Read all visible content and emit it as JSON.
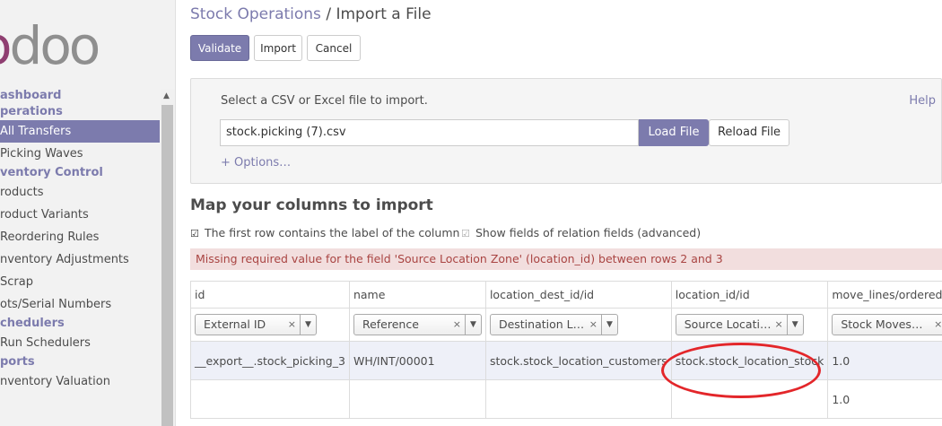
{
  "app": {
    "logo_first": "o",
    "logo_rest": "doo"
  },
  "sidebar": {
    "items": [
      {
        "label": "ashboard",
        "kind": "cat"
      },
      {
        "label": "perations",
        "kind": "cat"
      },
      {
        "label": "All Transfers",
        "kind": "active"
      },
      {
        "label": "Picking Waves",
        "kind": "sub"
      },
      {
        "label": "ventory Control",
        "kind": "cat"
      },
      {
        "label": "roducts",
        "kind": "sub"
      },
      {
        "label": "roduct Variants",
        "kind": "sub"
      },
      {
        "label": "Reordering Rules",
        "kind": "sub"
      },
      {
        "label": "nventory Adjustments",
        "kind": "sub"
      },
      {
        "label": "Scrap",
        "kind": "sub"
      },
      {
        "label": "ots/Serial Numbers",
        "kind": "sub"
      },
      {
        "label": "chedulers",
        "kind": "cat"
      },
      {
        "label": "Run Schedulers",
        "kind": "sub"
      },
      {
        "label": "ports",
        "kind": "cat"
      },
      {
        "label": "nventory Valuation",
        "kind": "sub"
      }
    ]
  },
  "header": {
    "crumb_link": "Stock Operations",
    "separator": "/",
    "crumb_current": "Import a File"
  },
  "toolbar": {
    "validate": "Validate",
    "import": "Import",
    "cancel": "Cancel"
  },
  "file_panel": {
    "prompt": "Select a CSV or Excel file to import.",
    "help": "Help",
    "file_value": "stock.picking (7).csv",
    "load": "Load File",
    "reload": "Reload File",
    "options": "+ Options…"
  },
  "mapping": {
    "title": "Map your columns to import",
    "first_row_label": "The first row contains the label of the column",
    "relation_fields_label": "Show fields of relation fields (advanced)",
    "error": "Missing required value for the field 'Source Location Zone' (location_id) between rows 2 and 3"
  },
  "table": {
    "headers": [
      "id",
      "name",
      "location_dest_id/id",
      "location_id/id",
      "move_lines/ordered_qty"
    ],
    "selects": [
      "External ID",
      "Reference",
      "Destination L…",
      "Source Locati…",
      "Stock Moves…"
    ],
    "rows": [
      [
        "__export__.stock_picking_3",
        "WH/INT/00001",
        "stock.stock_location_customers",
        "stock.stock_location_stock",
        "1.0"
      ],
      [
        "",
        "",
        "",
        "",
        "1.0"
      ]
    ]
  },
  "colors": {
    "accent": "#7c7bad",
    "logo_accent": "#8f3f71",
    "alert_bg": "#f2dede",
    "alert_text": "#a94442",
    "annotation": "#e3262a"
  }
}
